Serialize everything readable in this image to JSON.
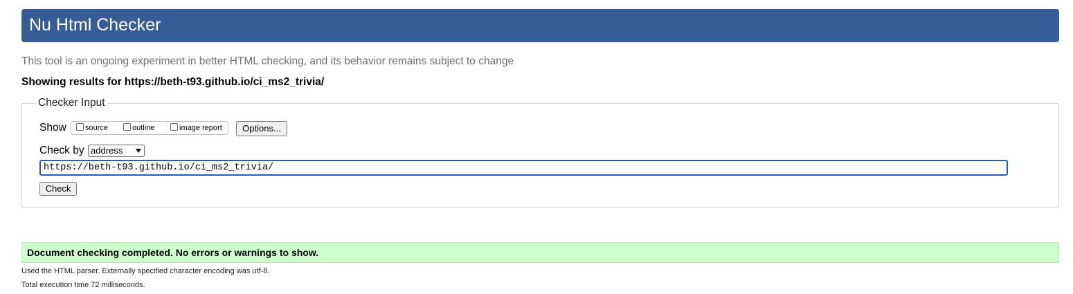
{
  "header": {
    "title": "Nu Html Checker"
  },
  "tagline": "This tool is an ongoing experiment in better HTML checking, and its behavior remains subject to change",
  "results": {
    "prefix": "Showing results for",
    "url": "https://beth-t93.github.io/ci_ms2_trivia/"
  },
  "checker_input": {
    "legend": "Checker Input",
    "show_label": "Show",
    "show_options": [
      {
        "label": "source",
        "checked": false
      },
      {
        "label": "outline",
        "checked": false
      },
      {
        "label": "image report",
        "checked": false
      }
    ],
    "options_button": "Options...",
    "check_by_label": "Check by",
    "check_by_selected": "address",
    "url_value": "https://beth-t93.github.io/ci_ms2_trivia/",
    "check_button": "Check"
  },
  "status": {
    "message": "Document checking completed. No errors or warnings to show.",
    "bg_color": "#ccffcc"
  },
  "info": {
    "parser": "Used the HTML parser. Externally specified character encoding was utf-8.",
    "execution_time": "Total execution time 72 milliseconds."
  },
  "colors": {
    "header_bg": "#365d95",
    "input_focus": "#1f5fbf"
  }
}
